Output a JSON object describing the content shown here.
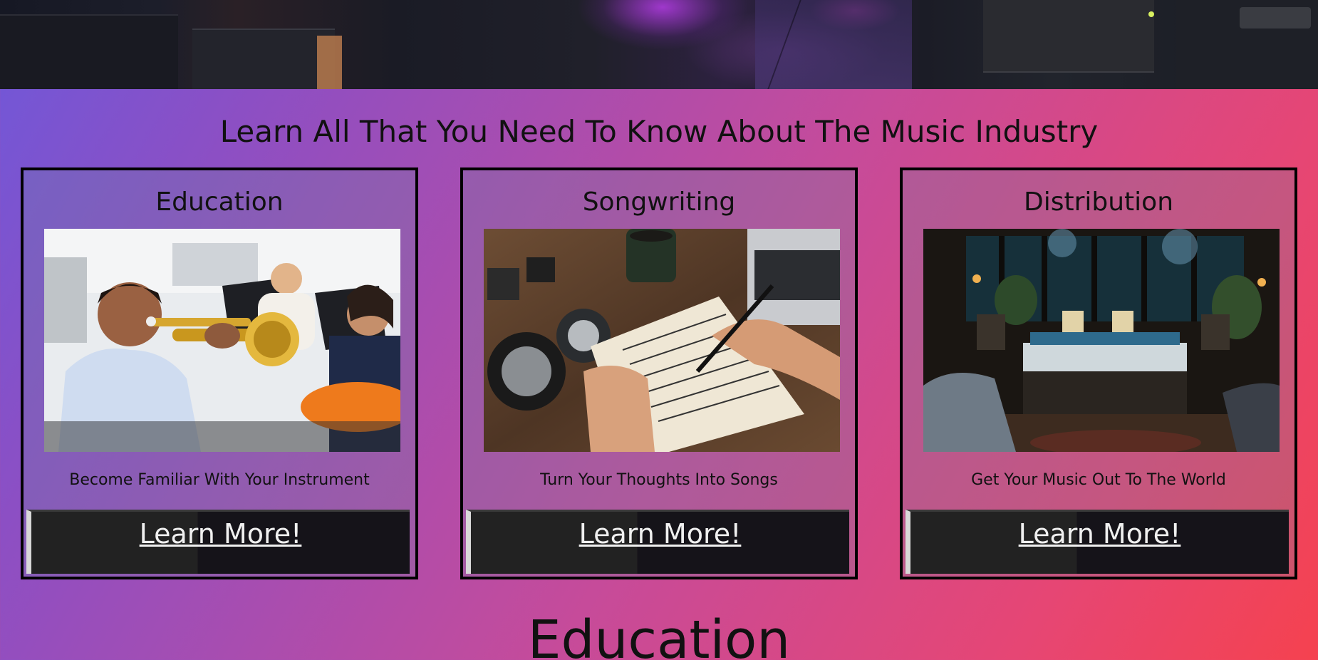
{
  "page": {
    "headline": "Learn All That You Need To Know About The Music Industry",
    "section_title": "Education"
  },
  "cards": [
    {
      "title": "Education",
      "description": "Become Familiar With Your Instrument",
      "button_label": "Learn More!",
      "image_subject": "students-playing-trumpet-and-guitar"
    },
    {
      "title": "Songwriting",
      "description": "Turn Your Thoughts Into Songs",
      "button_label": "Learn More!",
      "image_subject": "hand-writing-sheet-music"
    },
    {
      "title": "Distribution",
      "description": "Get Your Music Out To The World",
      "button_label": "Learn More!",
      "image_subject": "recording-studio-at-night"
    }
  ],
  "colors": {
    "gradient_left": "#6f58d9",
    "gradient_mid": "#c64b9a",
    "gradient_right": "#f5424f",
    "button_bg": "#222222",
    "text": "#111111"
  }
}
